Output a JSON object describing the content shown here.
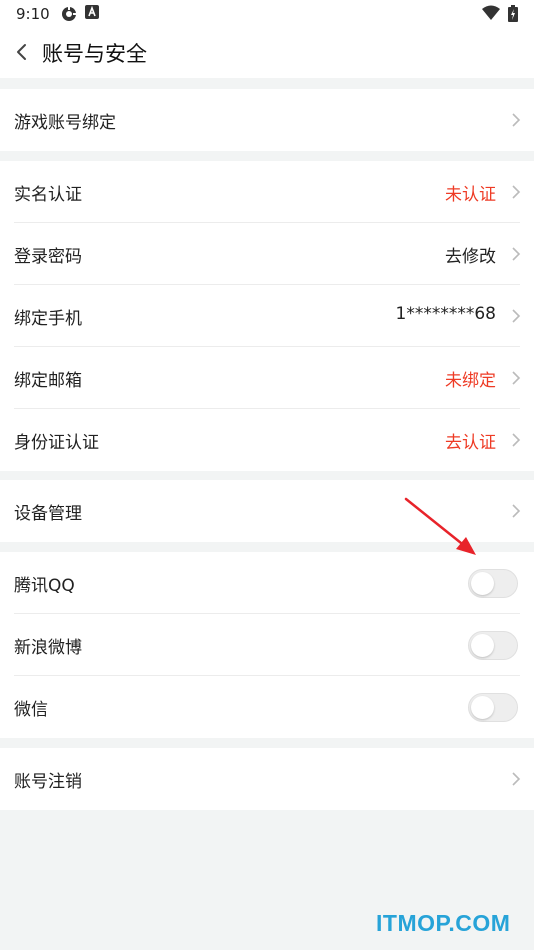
{
  "status_bar": {
    "time": "9:10",
    "icons": [
      "settings-app-icon",
      "a-app-icon",
      "wifi-icon",
      "battery-icon"
    ]
  },
  "header": {
    "title": "账号与安全",
    "back_icon": "chevron-left-icon"
  },
  "groups": [
    {
      "items": [
        {
          "label": "游戏账号绑定",
          "value": "",
          "status": "normal"
        }
      ]
    },
    {
      "items": [
        {
          "label": "实名认证",
          "value": "未认证",
          "status": "warning"
        },
        {
          "label": "登录密码",
          "value": "去修改",
          "status": "normal"
        },
        {
          "label": "绑定手机",
          "value": "1********68",
          "status": "normal"
        },
        {
          "label": "绑定邮箱",
          "value": "未绑定",
          "status": "warning"
        },
        {
          "label": "身份证认证",
          "value": "去认证",
          "status": "warning"
        }
      ]
    },
    {
      "items": [
        {
          "label": "设备管理",
          "value": "",
          "status": "normal"
        }
      ]
    },
    {
      "toggles": [
        {
          "label": "腾讯QQ",
          "enabled": false
        },
        {
          "label": "新浪微博",
          "enabled": false
        },
        {
          "label": "微信",
          "enabled": false
        }
      ]
    },
    {
      "items": [
        {
          "label": "账号注销",
          "value": "",
          "status": "normal"
        }
      ]
    }
  ],
  "colors": {
    "warning": "#ee3b25",
    "page_background": "#f2f4f4",
    "annotation_arrow": "#e8232a",
    "watermark": "#27a3d8"
  },
  "watermark": "ITMOP.COM"
}
